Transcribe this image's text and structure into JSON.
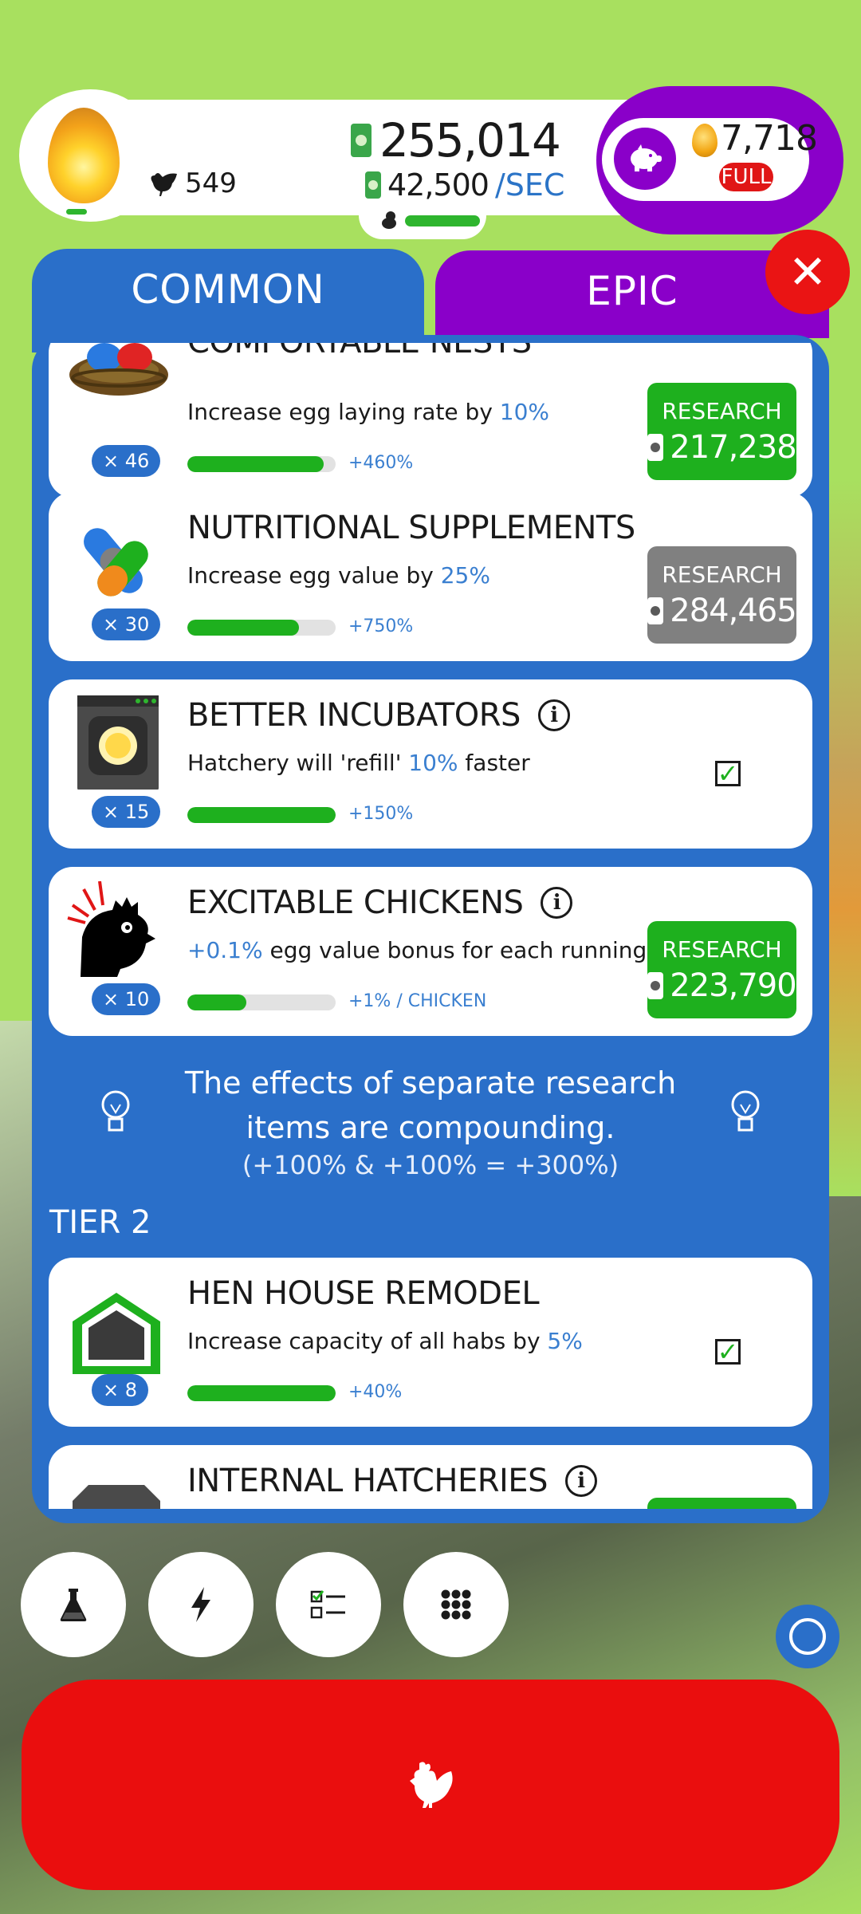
{
  "hud": {
    "chicken_count": "549",
    "money": "255,014",
    "rate_value": "42,500",
    "rate_unit": "/SEC",
    "golden_eggs": "7,718",
    "piggy_status": "FULL",
    "hatchery_fill": 1.0
  },
  "tabs": {
    "common": "COMMON",
    "epic": "EPIC"
  },
  "research": [
    {
      "title": "COMFORTABLE NESTS",
      "desc_prefix": "Increase egg laying rate by ",
      "desc_value": "10%",
      "desc_suffix": "",
      "count": "× 46",
      "bonus": "+460%",
      "progress": 0.92,
      "button_label": "RESEARCH",
      "cost": "217,238",
      "state": "available"
    },
    {
      "title": "NUTRITIONAL SUPPLEMENTS",
      "desc_prefix": "Increase egg value by ",
      "desc_value": "25%",
      "desc_suffix": "",
      "count": "× 30",
      "bonus": "+750%",
      "progress": 0.75,
      "button_label": "RESEARCH",
      "cost": "284,465",
      "state": "unaffordable"
    },
    {
      "title": "BETTER INCUBATORS",
      "desc_prefix": "Hatchery will 'refill' ",
      "desc_value": "10%",
      "desc_suffix": " faster",
      "count": "× 15",
      "bonus": "+150%",
      "progress": 1.0,
      "state": "complete"
    },
    {
      "title": "EXCITABLE CHICKENS",
      "desc_prefix": "",
      "desc_value": "+0.1%",
      "desc_suffix": " egg value bonus for each running chicken",
      "count": "× 10",
      "bonus": "+1% / CHICKEN",
      "progress": 0.4,
      "button_label": "RESEARCH",
      "cost": "223,790",
      "state": "available"
    }
  ],
  "tip": {
    "line": "The effects of separate research items are compounding.",
    "example": "(+100% & +100% = +300%)"
  },
  "tier_label": "TIER 2",
  "tier2": [
    {
      "title": "HEN HOUSE REMODEL",
      "desc_prefix": "Increase capacity of all habs by ",
      "desc_value": "5%",
      "count": "× 8",
      "bonus": "+40%",
      "progress": 1.0,
      "state": "complete"
    },
    {
      "title": "INTERNAL HATCHERIES",
      "state": "available"
    }
  ],
  "colors": {
    "background": "#a8e05f",
    "panel": "#2a6fc9",
    "epic": "#8a00c9",
    "research_green": "#1eb01e",
    "close_red": "#ea1414",
    "hatch_red": "#ea0e0e"
  },
  "bottom_buttons": [
    "flask-icon",
    "lightning-icon",
    "checklist-icon",
    "grid-icon"
  ]
}
